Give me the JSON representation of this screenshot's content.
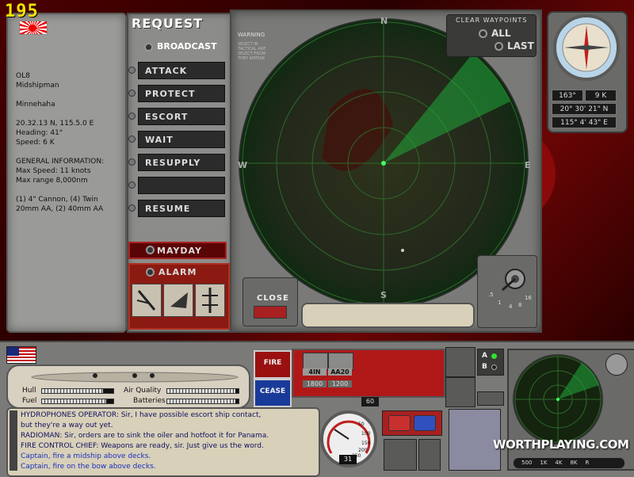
{
  "hud": {
    "fps": "195"
  },
  "ship_info": {
    "lines": "OL8\nMidshipman\n\nMinnehaha\n\n20.32.13 N, 115.5.0 E\nHeading: 41°\nSpeed: 6 K\n\nGENERAL INFORMATION:\nMax Speed: 11 knots\nMax range 8,000nm\n\n(1) 4\" Cannon, (4) Twin\n    20mm AA, (2) 40mm AA"
  },
  "request": {
    "title": "REQUEST",
    "broadcast": "BROADCAST",
    "buttons": [
      "ATTACK",
      "PROTECT",
      "ESCORT",
      "WAIT",
      "RESUPPLY",
      "",
      "RESUME"
    ],
    "mayday": "MAYDAY",
    "alarm": "ALARM"
  },
  "radar": {
    "warning": "WARNING",
    "warning_small": "SELECT IN TACTICAL ARE SELECT FROM THEY APPEAR",
    "cardinals": {
      "n": "N",
      "s": "S",
      "e": "E",
      "w": "W"
    },
    "clear_waypoints": "CLEAR WAYPOINTS",
    "all": "ALL",
    "last": "LAST",
    "close": "CLOSE",
    "range_ticks": [
      ".5",
      "1",
      "4",
      "8",
      "16"
    ]
  },
  "nav": {
    "heading": "163°",
    "speed": "9 K",
    "lat": "20° 30' 21\" N",
    "lon": "115° 4' 43\" E"
  },
  "status": {
    "hull": "Hull",
    "fuel": "Fuel",
    "air": "Air Quality",
    "batteries": "Batteries",
    "hull_level": 0.85,
    "fuel_level": 0.9,
    "air_level": 0.95,
    "batteries_level": 0.95
  },
  "log": [
    {
      "text": "HYDROPHONES OPERATOR:  Sir, I have possible escort ship contact,",
      "color": "#101060"
    },
    {
      "text": "     but they're a way out yet.",
      "color": "#101060"
    },
    {
      "text": "RADIOMAN:  Sir, orders are to sink the oiler and hotfoot it for Panama.",
      "color": "#101060"
    },
    {
      "text": "FIRE CONTROL CHIEF:  Weapons are ready, sir.  Just give us the word.",
      "color": "#101060"
    },
    {
      "text": "Captain, fire a midship above decks.",
      "color": "#1a30c0"
    },
    {
      "text": "Captain, fire on the bow above decks.",
      "color": "#1a30c0"
    }
  ],
  "weapons": {
    "fire": "FIRE",
    "cease": "CEASE",
    "items": [
      {
        "label": "4IN",
        "count": "1800"
      },
      {
        "label": "AA20",
        "count": "1200"
      }
    ],
    "ammo": "60"
  },
  "gauge": {
    "value": "31",
    "ticks": [
      "50",
      "100",
      "150",
      "200",
      "250"
    ]
  },
  "selector": {
    "a": "A",
    "b": "B"
  },
  "watermark": "WORTHPLAYING.COM",
  "zoom": [
    "500",
    "1K",
    "4K",
    "8K",
    "R"
  ],
  "colors": {
    "radar_green": "#0a3a10",
    "sweep": "#1fa83a",
    "panel_gray": "#8c8c8a",
    "alarm_red": "#8a1a12"
  }
}
